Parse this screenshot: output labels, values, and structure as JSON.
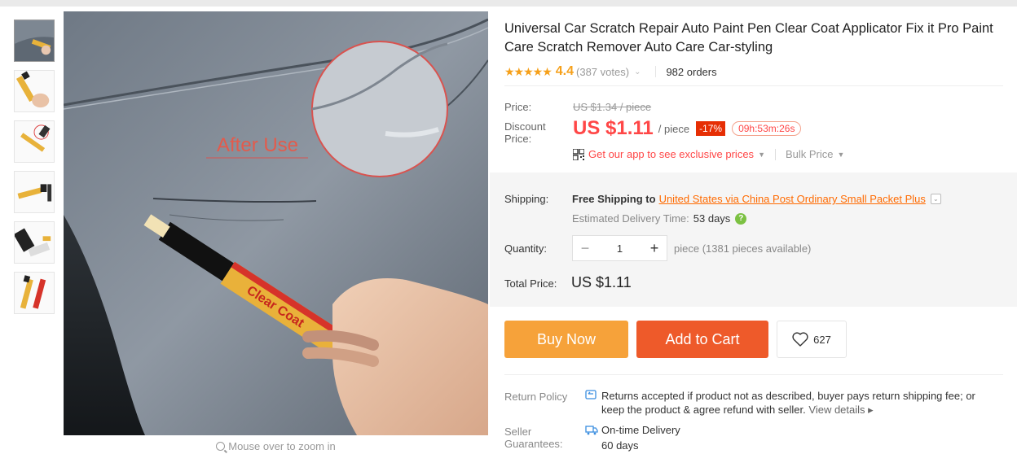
{
  "product": {
    "title": "Universal Car Scratch Repair Auto Paint Pen Clear Coat Applicator Fix it Pro Paint Care Scratch Remover Auto Care Car-styling",
    "stars": "★★★★★",
    "rating": "4.4",
    "votes": "(387 votes)",
    "orders": "982 orders"
  },
  "gallery": {
    "image_caption": "After Use",
    "zoom_hint": "Mouse over to zoom in",
    "thumbnail_count": 6
  },
  "price": {
    "price_label": "Price:",
    "original": "US $1.34 / piece",
    "discount_label": "Discount Price:",
    "current": "US $1.11",
    "per_piece": "/ piece",
    "discount_badge": "-17%",
    "countdown": "09h:53m:26s",
    "app_promo": "Get our app to see exclusive prices",
    "bulk_price": "Bulk Price"
  },
  "shipping": {
    "label": "Shipping:",
    "free_text": "Free Shipping to",
    "destination_link": "United States via China Post Ordinary Small Packet Plus",
    "est_label": "Estimated Delivery Time:",
    "est_days": "53 days"
  },
  "quantity": {
    "label": "Quantity:",
    "value": "1",
    "minus": "−",
    "plus": "+",
    "availability": "piece (1381 pieces available)"
  },
  "total": {
    "label": "Total Price:",
    "value": "US $1.11"
  },
  "actions": {
    "buy_now": "Buy Now",
    "add_to_cart": "Add to Cart",
    "wishlist_count": "627"
  },
  "policy": {
    "return_label": "Return Policy",
    "return_text": "Returns accepted if product not as described, buyer pays return shipping fee; or keep the product & agree refund with seller.",
    "view_details": "View details ▸",
    "seller_label": "Seller Guarantees:",
    "on_time": "On-time Delivery",
    "on_time_days": "60 days"
  },
  "colors": {
    "price_red": "#ff4747",
    "buy_orange": "#f6a23a",
    "cart_orange": "#ee5a2a",
    "star_gold": "#f6a01a"
  }
}
